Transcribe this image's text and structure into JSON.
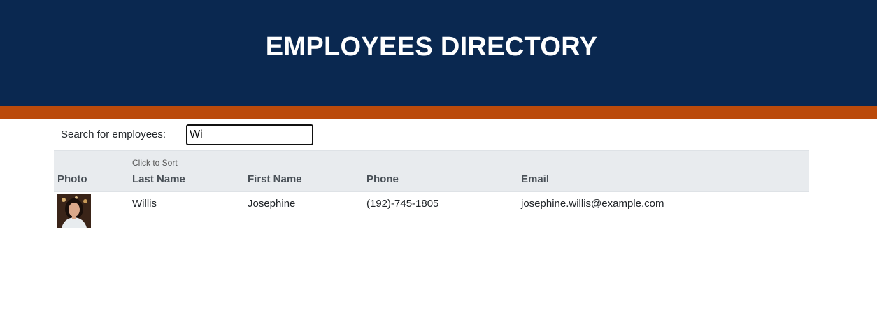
{
  "header": {
    "title": "EMPLOYEES DIRECTORY"
  },
  "search": {
    "label": "Search for employees:",
    "value": "Wi"
  },
  "table": {
    "sort_hint": "Click to Sort",
    "columns": [
      "Photo",
      "Last Name",
      "First Name",
      "Phone",
      "Email"
    ],
    "rows": [
      {
        "last_name": "Willis",
        "first_name": "Josephine",
        "phone": "(192)-745-1805",
        "email": "josephine.willis@example.com"
      }
    ]
  },
  "colors": {
    "header_bg": "#0a2850",
    "accent": "#bb4a0a",
    "table_head_bg": "#e8ebee"
  }
}
